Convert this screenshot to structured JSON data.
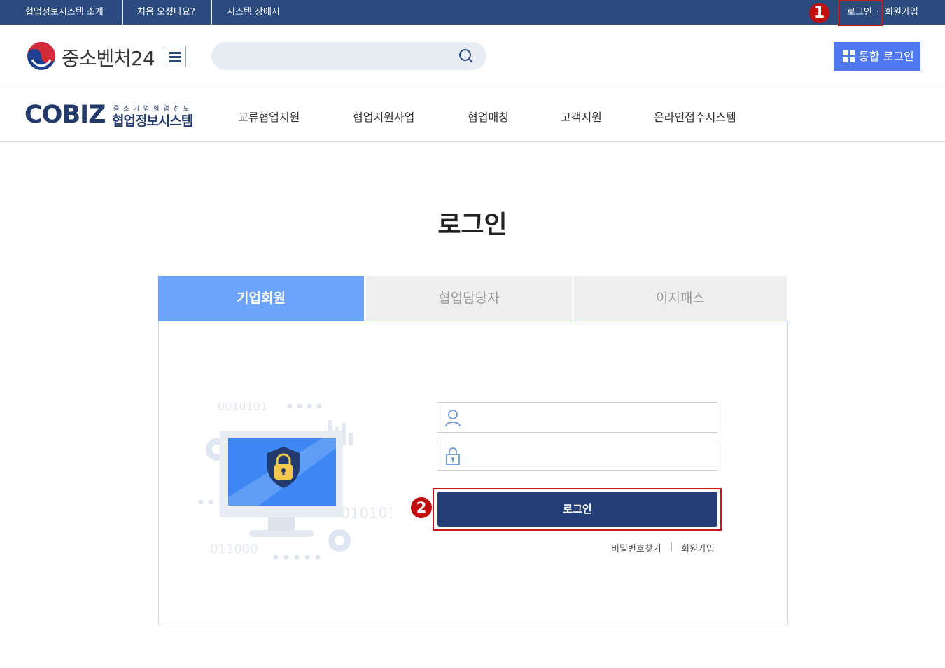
{
  "topbar": {
    "links": [
      "협업정보시스템 소개",
      "처음 오셨나요?",
      "시스템 장애시"
    ],
    "login": "로그인",
    "dot": "·",
    "signup": "회원가입",
    "marker1": "1"
  },
  "header": {
    "brand": "중소벤처24",
    "search_placeholder": "",
    "integrated_login": "통합 로그인"
  },
  "logo": {
    "main": "COBIZ",
    "tagline": "중소기업협업선도",
    "sub": "협업정보시스템"
  },
  "gnb": [
    "교류협업지원",
    "협업지원사업",
    "협업매칭",
    "고객지원",
    "온라인접수시스템"
  ],
  "page": {
    "title": "로그인"
  },
  "tabs": [
    {
      "label": "기업회원",
      "active": true
    },
    {
      "label": "협업담당자",
      "active": false
    },
    {
      "label": "이지패스",
      "active": false
    }
  ],
  "form": {
    "id_value": "",
    "pw_value": "",
    "login_button": "로그인",
    "marker2": "2",
    "find_password": "비밀번호찾기",
    "divider": "|",
    "signup": "회원가입"
  },
  "illustration": {
    "binary_texts": [
      "0010101",
      "010101",
      "011000"
    ]
  },
  "colors": {
    "navy": "#2b4a7e",
    "button_navy": "#243f77",
    "tab_active": "#6ba4fa",
    "integrated_blue": "#5078f0",
    "marker_red": "#c00d0d"
  }
}
